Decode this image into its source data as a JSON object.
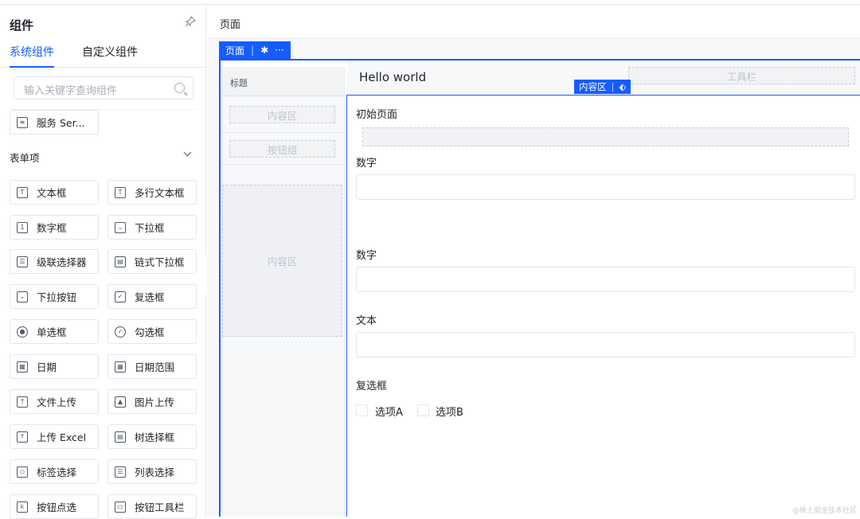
{
  "left": {
    "title": "组件",
    "tabs": [
      "系统组件",
      "自定义组件"
    ],
    "search_placeholder": "输入关键字查询组件",
    "service_item": "服务 Ser...",
    "section": "表单项",
    "items": [
      [
        "文本框",
        "多行文本框"
      ],
      [
        "数字框",
        "下拉框"
      ],
      [
        "级联选择器",
        "链式下拉框"
      ],
      [
        "下拉按钮",
        "复选框"
      ],
      [
        "单选框",
        "勾选框"
      ],
      [
        "日期",
        "日期范围"
      ],
      [
        "文件上传",
        "图片上传"
      ],
      [
        "上传 Excel",
        "树选择框"
      ],
      [
        "标签选择",
        "列表选择"
      ],
      [
        "按钮点选",
        "按钮工具栏"
      ]
    ]
  },
  "right": {
    "header": "页面",
    "page_badge": "页面",
    "page_badge_more": "···",
    "sidebar": {
      "title": "标题",
      "content1": "内容区",
      "buttons": "按钮组",
      "content2": "内容区"
    },
    "hello": "Hello world",
    "toolbar": "工具栏",
    "content_badge": "内容区",
    "form": {
      "init_page": "初始页面",
      "fields": [
        "数字",
        "数字",
        "文本"
      ],
      "checkbox_label": "复选框",
      "options": [
        "选项A",
        "选项B"
      ]
    },
    "watermark": "@稀土掘金技术社区"
  }
}
